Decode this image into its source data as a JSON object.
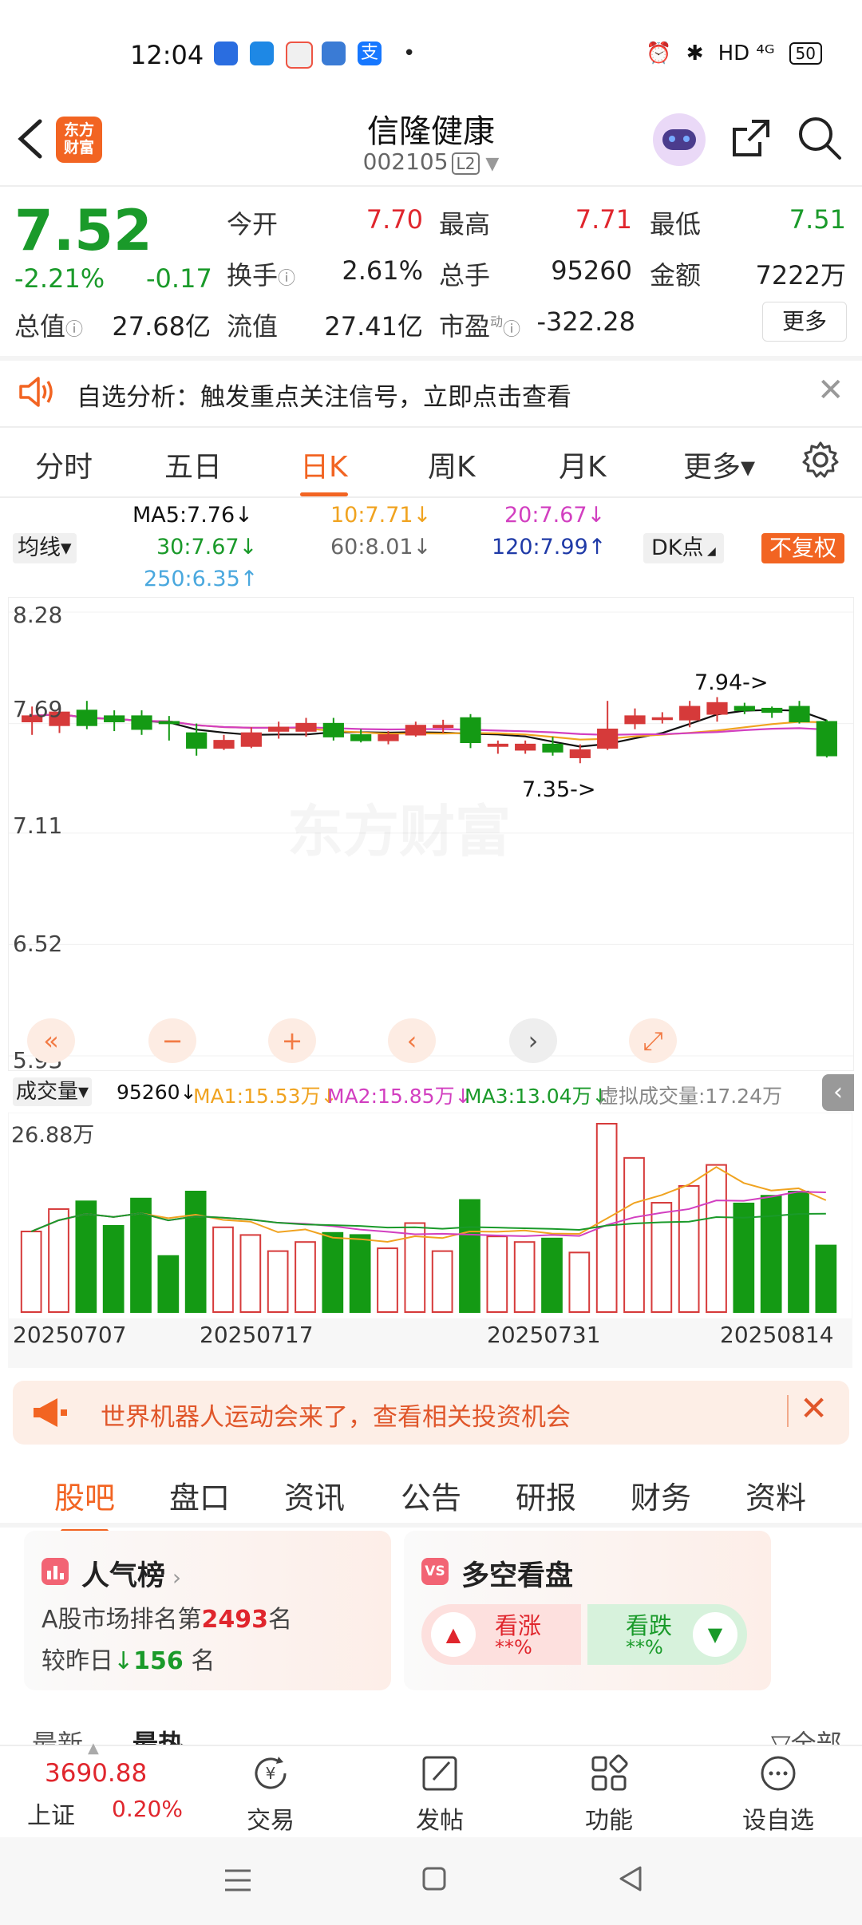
{
  "status_bar": {
    "time": "12:04",
    "right_text": "HD ⁴ᴳ",
    "battery": "50"
  },
  "header": {
    "title": "信隆健康",
    "code": "002105",
    "level": "L2",
    "logo_text": "东方\n财富"
  },
  "quote": {
    "price": "7.52",
    "change_pct": "-2.21%",
    "change_abs": "-0.17",
    "open_label": "今开",
    "open_value": "7.70",
    "high_label": "最高",
    "high_value": "7.71",
    "low_label": "最低",
    "low_value": "7.51",
    "turnover_label": "换手",
    "turnover_value": "2.61%",
    "volume_label": "总手",
    "volume_value": "95260",
    "amount_label": "金额",
    "amount_value": "7222万",
    "mktcap_label": "总值",
    "mktcap_value": "27.68亿",
    "float_label": "流值",
    "float_value": "27.41亿",
    "pe_label": "市盈",
    "pe_sup": "动",
    "pe_value": "-322.28",
    "more_label": "更多"
  },
  "notice": {
    "text": "自选分析：触发重点关注信号，立即点击查看"
  },
  "kline_tabs": [
    {
      "label": "分时"
    },
    {
      "label": "五日"
    },
    {
      "label": "日K",
      "active": true
    },
    {
      "label": "周K"
    },
    {
      "label": "月K"
    },
    {
      "label": "更多▾"
    }
  ],
  "ma_panel": {
    "selector": "均线▾",
    "ma5": "MA5:7.76↓",
    "ma10": "10:7.71↓",
    "ma20": "20:7.67↓",
    "ma30": "30:7.67↓",
    "ma60": "60:8.01↓",
    "ma120": "120:7.99↑",
    "ma250": "250:6.35↑",
    "dk_label": "DK点",
    "fuquan": "不复权"
  },
  "chart_data": {
    "type": "candlestick",
    "y_ticks": [
      "8.28",
      "7.69",
      "7.11",
      "6.52",
      "5.93"
    ],
    "annotations": [
      "7.94->",
      "7.35->"
    ],
    "x_dates": [
      "20250707",
      "20250717",
      "20250731",
      "20250814"
    ],
    "candles": [
      {
        "o": 7.7,
        "c": 7.73,
        "h": 7.78,
        "l": 7.63
      },
      {
        "o": 7.68,
        "c": 7.75,
        "h": 7.78,
        "l": 7.64
      },
      {
        "o": 7.76,
        "c": 7.68,
        "h": 7.81,
        "l": 7.66
      },
      {
        "o": 7.73,
        "c": 7.7,
        "h": 7.76,
        "l": 7.65
      },
      {
        "o": 7.73,
        "c": 7.66,
        "h": 7.76,
        "l": 7.63
      },
      {
        "o": 7.7,
        "c": 7.69,
        "h": 7.73,
        "l": 7.6
      },
      {
        "o": 7.64,
        "c": 7.56,
        "h": 7.69,
        "l": 7.52
      },
      {
        "o": 7.56,
        "c": 7.6,
        "h": 7.63,
        "l": 7.55
      },
      {
        "o": 7.57,
        "c": 7.64,
        "h": 7.67,
        "l": 7.56
      },
      {
        "o": 7.65,
        "c": 7.67,
        "h": 7.7,
        "l": 7.61
      },
      {
        "o": 7.65,
        "c": 7.69,
        "h": 7.72,
        "l": 7.62
      },
      {
        "o": 7.69,
        "c": 7.62,
        "h": 7.72,
        "l": 7.6
      },
      {
        "o": 7.63,
        "c": 7.6,
        "h": 7.66,
        "l": 7.59
      },
      {
        "o": 7.6,
        "c": 7.63,
        "h": 7.65,
        "l": 7.58
      },
      {
        "o": 7.63,
        "c": 7.68,
        "h": 7.7,
        "l": 7.62
      },
      {
        "o": 7.67,
        "c": 7.68,
        "h": 7.71,
        "l": 7.64
      },
      {
        "o": 7.72,
        "c": 7.59,
        "h": 7.74,
        "l": 7.56
      },
      {
        "o": 7.57,
        "c": 7.58,
        "h": 7.6,
        "l": 7.53
      },
      {
        "o": 7.55,
        "c": 7.58,
        "h": 7.6,
        "l": 7.53
      },
      {
        "o": 7.58,
        "c": 7.54,
        "h": 7.62,
        "l": 7.52
      },
      {
        "o": 7.51,
        "c": 7.55,
        "h": 7.58,
        "l": 7.48
      },
      {
        "o": 7.56,
        "c": 7.66,
        "h": 7.81,
        "l": 7.55
      },
      {
        "o": 7.69,
        "c": 7.73,
        "h": 7.77,
        "l": 7.66
      },
      {
        "o": 7.72,
        "c": 7.72,
        "h": 7.75,
        "l": 7.69
      },
      {
        "o": 7.71,
        "c": 7.78,
        "h": 7.81,
        "l": 7.67
      },
      {
        "o": 7.74,
        "c": 7.8,
        "h": 7.83,
        "l": 7.7
      },
      {
        "o": 7.78,
        "c": 7.76,
        "h": 7.8,
        "l": 7.74
      },
      {
        "o": 7.77,
        "c": 7.75,
        "h": 7.78,
        "l": 7.72
      },
      {
        "o": 7.78,
        "c": 7.7,
        "h": 7.81,
        "l": 7.69
      },
      {
        "o": 7.7,
        "c": 7.52,
        "h": 7.71,
        "l": 7.51
      }
    ],
    "volume_panel": {
      "selector": "成交量▾",
      "vol": "95260↓",
      "ma1": "MA1:15.53万↓",
      "ma2": "MA2:15.85万↓",
      "ma3": "MA3:13.04万↓",
      "virtual": "虚拟成交量:17.24万",
      "max_label": "26.88万",
      "values": [
        11.5,
        14.7,
        15.8,
        12.3,
        16.2,
        8.0,
        17.2,
        12.1,
        11.0,
        8.7,
        10.0,
        11.3,
        11.0,
        9.1,
        12.7,
        8.7,
        16.0,
        10.8,
        10.0,
        10.5,
        8.5,
        26.88,
        22.0,
        15.6,
        18.0,
        21.0,
        15.5,
        16.6,
        17.2,
        9.5
      ]
    },
    "colors": {
      "up": "#d63a3a",
      "down": "#149a14",
      "ma5": "#111111",
      "ma10": "#f0a320",
      "ma20": "#d23fc0",
      "ma30": "#1a9a2a",
      "ma60": "#777777",
      "ma120": "#1f3aa7",
      "ma250": "#4aa8de"
    }
  },
  "chart_controls": [
    "«",
    "−",
    "+",
    "‹",
    "›",
    "⤢"
  ],
  "banner": {
    "text": "世界机器人运动会来了，查看相关投资机会"
  },
  "bottom_tabs": [
    {
      "label": "股吧",
      "active": true
    },
    {
      "label": "盘口"
    },
    {
      "label": "资讯"
    },
    {
      "label": "公告"
    },
    {
      "label": "研报"
    },
    {
      "label": "财务"
    },
    {
      "label": "资料"
    }
  ],
  "popularity": {
    "title": "人气榜",
    "rank_prefix": "A股市场排名第",
    "rank": "2493",
    "rank_suffix": "名",
    "change_prefix": "较昨日",
    "change": "156",
    "change_suffix": "名"
  },
  "sentiment": {
    "title": "多空看盘",
    "bull": "看涨",
    "bull_val": "**%",
    "bear": "看跌",
    "bear_val": "**%"
  },
  "partial_tabs": {
    "left": "最新",
    "middle": "最热",
    "right": "全部"
  },
  "index": {
    "value": "3690.88",
    "name": "上证",
    "pct": "0.20%"
  },
  "nav": [
    {
      "label": "交易",
      "icon": "trade-icon"
    },
    {
      "label": "发帖",
      "icon": "edit-icon"
    },
    {
      "label": "功能",
      "icon": "grid-icon"
    },
    {
      "label": "设自选",
      "icon": "more-icon"
    }
  ]
}
